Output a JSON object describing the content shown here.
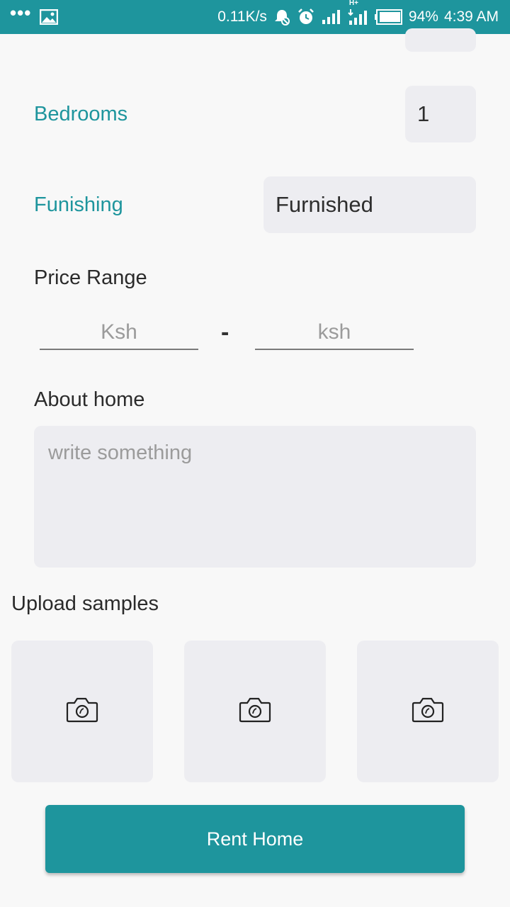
{
  "status_bar": {
    "network_speed": "0.11K/s",
    "network_type": "H+",
    "battery": "94%",
    "time": "4:39 AM",
    "overflow_dots": "•••"
  },
  "form": {
    "bedrooms": {
      "label": "Bedrooms",
      "value": "1"
    },
    "furnishing": {
      "label": "Funishing",
      "value": "Furnished"
    },
    "price_range": {
      "title": "Price Range",
      "min_placeholder": "Ksh",
      "separator": "-",
      "max_placeholder": "ksh"
    },
    "about": {
      "title": "About home",
      "placeholder": "write something"
    },
    "upload": {
      "title": "Upload samples",
      "tiles": [
        "camera-icon",
        "camera-icon",
        "camera-icon"
      ]
    },
    "submit_label": "Rent Home"
  },
  "colors": {
    "accent": "#1e959d",
    "field_background": "#ededf1",
    "page_background": "#f8f8f8"
  }
}
